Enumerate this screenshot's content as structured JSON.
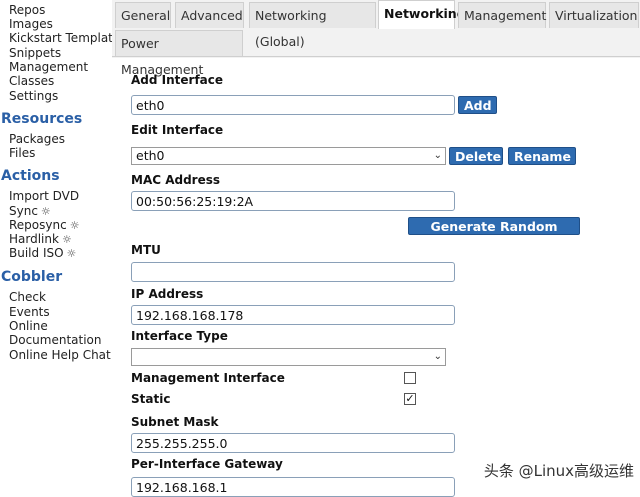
{
  "sidebar": {
    "top_items": [
      "Repos",
      "Images",
      "Kickstart Templates",
      "Snippets",
      "Management Classes",
      "Settings"
    ],
    "resources_heading": "Resources",
    "resources_items": [
      "Packages",
      "Files"
    ],
    "actions_heading": "Actions",
    "actions_items": [
      "Import DVD",
      "Sync",
      "Reposync",
      "Hardlink",
      "Build ISO"
    ],
    "cobbler_heading": "Cobbler",
    "cobbler_items": [
      "Check",
      "Events",
      "Online Documentation",
      "Online Help Chat"
    ]
  },
  "tabs": [
    "General",
    "Advanced",
    "Networking (Global)",
    "Networking",
    "Management",
    "Virtualization",
    "Power Management"
  ],
  "form": {
    "add_interface_label": "Add Interface",
    "add_interface_value": "eth0",
    "add_button": "Add",
    "edit_interface_label": "Edit Interface",
    "edit_interface_selected": "eth0",
    "delete_button": "Delete",
    "rename_button": "Rename",
    "mac_label": "MAC Address",
    "mac_value": "00:50:56:25:19:2A",
    "random_mac_button": "Generate Random MAC",
    "mtu_label": "MTU",
    "mtu_value": "",
    "ip_label": "IP Address",
    "ip_value": "192.168.168.178",
    "interface_type_label": "Interface Type",
    "interface_type_selected": "",
    "management_interface_label": "Management Interface",
    "management_interface_checked": false,
    "static_label": "Static",
    "static_checked": true,
    "subnet_label": "Subnet Mask",
    "subnet_value": "255.255.255.0",
    "gateway_label": "Per-Interface Gateway",
    "gateway_value": "192.168.168.1"
  },
  "watermark": "头条 @Linux高级运维",
  "colors": {
    "accent": "#2e6bb0",
    "heading": "#2a5fa6"
  },
  "icons": {
    "gear": "☼",
    "check": "✓",
    "caret": "⌄"
  }
}
